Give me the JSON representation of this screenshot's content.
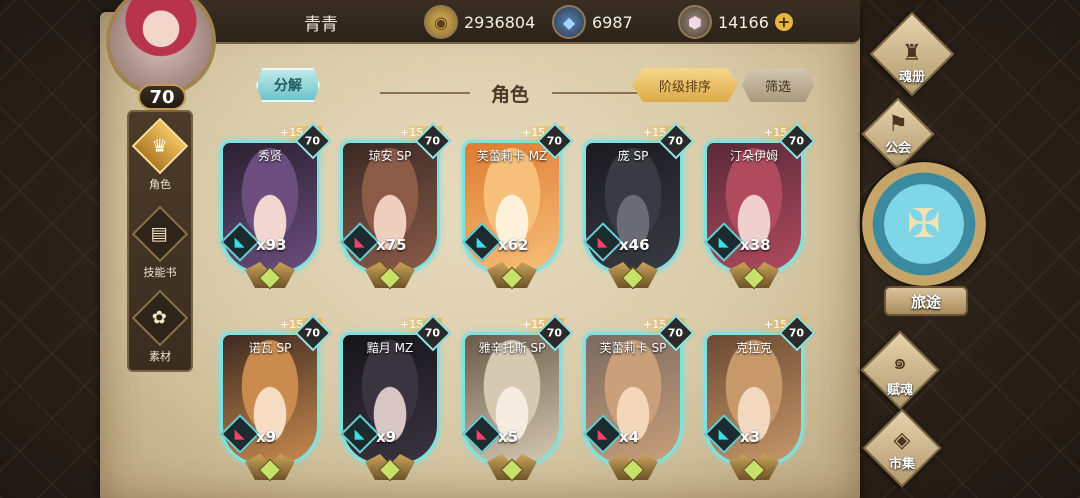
{
  "player": {
    "name": "青青",
    "level": "70"
  },
  "resources": {
    "gold": {
      "icon": "gold-coin-icon",
      "value": "2936804"
    },
    "gem": {
      "icon": "blue-gem-icon",
      "value": "6987"
    },
    "crystal": {
      "icon": "crystal-icon",
      "value": "14166",
      "add": "+"
    }
  },
  "left_nav": [
    {
      "label": "角色",
      "icon": "character-icon",
      "active": true
    },
    {
      "label": "技能书",
      "icon": "skill-book-icon",
      "active": false
    },
    {
      "label": "素材",
      "icon": "material-icon",
      "active": false
    }
  ],
  "header": {
    "decompose": "分解",
    "title": "角色",
    "sort": "阶级排序",
    "filter": "筛选"
  },
  "cards": [
    {
      "name": "秀贤",
      "level": "70",
      "stars": "+15",
      "count": "x93",
      "element": "cyan",
      "palette": [
        "#2a2030",
        "#6b4e7e",
        "#f1d7d0"
      ]
    },
    {
      "name": "琼安 SP",
      "level": "70",
      "stars": "+15",
      "count": "x75",
      "element": "red",
      "palette": [
        "#3a2a25",
        "#8b5b48",
        "#f0cfc0"
      ]
    },
    {
      "name": "芙蕾莉卡 MZ",
      "level": "70",
      "stars": "+15",
      "count": "x62",
      "element": "cyan",
      "palette": [
        "#e07a30",
        "#f6c07a",
        "#fff1dc"
      ]
    },
    {
      "name": "庞 SP",
      "level": "70",
      "stars": "+15",
      "count": "x46",
      "element": "red",
      "palette": [
        "#1a1a1f",
        "#3a3a44",
        "#6b6b78"
      ]
    },
    {
      "name": "汀朵伊姆",
      "level": "70",
      "stars": "+15",
      "count": "x38",
      "element": "cyan",
      "palette": [
        "#5a2a3a",
        "#b04a5e",
        "#f0d0cf"
      ]
    },
    {
      "name": "诺瓦 SP",
      "level": "70",
      "stars": "+15",
      "count": "x9",
      "element": "red",
      "palette": [
        "#3e2a22",
        "#c98b4e",
        "#f7dcc4"
      ]
    },
    {
      "name": "黯月 MZ",
      "level": "70",
      "stars": "+15",
      "count": "x9",
      "element": "cyan",
      "palette": [
        "#151519",
        "#3a3440",
        "#d8c6c4"
      ]
    },
    {
      "name": "雅辛托斯 SP",
      "level": "70",
      "stars": "+15",
      "count": "x5",
      "element": "red",
      "palette": [
        "#6a5a4a",
        "#d6c9b2",
        "#f5ece0"
      ]
    },
    {
      "name": "芙蕾莉卡 SP",
      "level": "70",
      "stars": "+15",
      "count": "x4",
      "element": "red",
      "palette": [
        "#7a6a60",
        "#c9a07a",
        "#f4d7b8"
      ]
    },
    {
      "name": "克拉克",
      "level": "70",
      "stars": "+15",
      "count": "x3",
      "element": "cyan",
      "palette": [
        "#6a4a32",
        "#c7986a",
        "#f2d8bf"
      ]
    }
  ],
  "right_nav": {
    "soul_book": "魂册",
    "guild": "公会",
    "journey": "旅途",
    "soul_gift": "赋魂",
    "market": "市集"
  }
}
